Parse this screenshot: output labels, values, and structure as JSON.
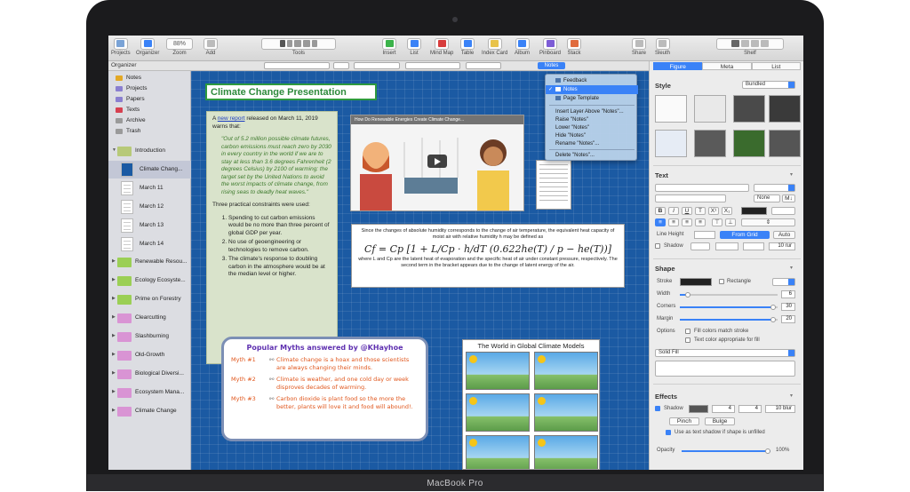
{
  "device": {
    "brand": "MacBook Pro"
  },
  "toolbar": {
    "items": [
      {
        "label": "Projects"
      },
      {
        "label": "Organizer"
      },
      {
        "label": "Zoom",
        "value": "88%"
      },
      {
        "label": "Add"
      },
      {
        "label": "Tools"
      },
      {
        "label": "Insert"
      },
      {
        "label": "List"
      },
      {
        "label": "Mind Map"
      },
      {
        "label": "Table"
      },
      {
        "label": "Index Card"
      },
      {
        "label": "Album"
      },
      {
        "label": "Pinboard"
      },
      {
        "label": "Stack"
      },
      {
        "label": "Share"
      },
      {
        "label": "Sleuth"
      },
      {
        "label": "Shelf"
      }
    ],
    "organizer_label": "Organizer",
    "notes_popup": "Notes"
  },
  "sidebar": {
    "top": [
      {
        "label": "Notes",
        "color": "#e3a825"
      },
      {
        "label": "Projects",
        "color": "#8a7fd0"
      },
      {
        "label": "Papers",
        "color": "#8a7fd0"
      },
      {
        "label": "Texts",
        "color": "#d64050"
      },
      {
        "label": "Archive",
        "color": "#9a9a9a"
      },
      {
        "label": "Trash",
        "color": "#9a9a9a"
      }
    ],
    "intro": "Introduction",
    "docs": [
      "Climate Chang...",
      "March 11",
      "March 12",
      "March 13",
      "March 14"
    ],
    "folders": [
      {
        "label": "Renewable Resou...",
        "color": "#9bcf55"
      },
      {
        "label": "Ecology Ecosyste...",
        "color": "#9bcf55"
      },
      {
        "label": "Prime on Forestry",
        "color": "#9bcf55"
      },
      {
        "label": "Clearcutting",
        "color": "#d994d4"
      },
      {
        "label": "Slashburning",
        "color": "#d994d4"
      },
      {
        "label": "Old-Growth",
        "color": "#d994d4"
      },
      {
        "label": "Biological Diversi...",
        "color": "#d994d4"
      },
      {
        "label": "Ecosystem Mana...",
        "color": "#d994d4"
      },
      {
        "label": "Climate Change",
        "color": "#d994d4"
      }
    ]
  },
  "canvas": {
    "title": "Climate Change Presentation",
    "note": {
      "intro_pre": "A ",
      "intro_link": "new report",
      "intro_post": " released on March 11, 2019 warns that:",
      "quote": "\"Out of 5.2 million possible climate futures, carbon emissions must reach zero by 2030 in every country in the world if we are to stay at less than 3.6 degrees Fahrenheit (2 degrees Celsius) by 2100 of warming: the target set by the United Nations to avoid the worst impacts of climate change, from rising seas to deadly heat waves.\"",
      "constraints_intro": "Three practical constraints were used:",
      "constraints": [
        "Spending to cut carbon emissions would be no more than three percent of global GDP per year.",
        "No use of geoengineering or technologies to remove carbon.",
        "The climate's response to doubling carbon in the atmosphere would be at the median level or higher."
      ]
    },
    "video_title": "How Do Renewable Energies Create Climate Change...",
    "equation": {
      "text_top": "Since the changes of absolute humidity corresponds to the change of air temperature, the equivalent heat capacity of moist air with relative humidity h may be defined as",
      "formula": "Cf = Cp [1 + L/Cp · h/dT (0.622he(T) / p − he(T))]",
      "text_bottom": "where L and Cp are the latent heat of evaporation and the specific heat of air under constant pressure, respectively. The second term in the bracket appears due to the change of latent energy of the air."
    },
    "myths": {
      "title": "Popular Myths answered by @KHayhoe",
      "items": [
        {
          "num": "Myth #1",
          "text": "Climate change is a hoax and those scientists are always changing their minds."
        },
        {
          "num": "Myth #2",
          "text": "Climate is weather, and one cold day or week disproves decades of warming."
        },
        {
          "num": "Myth #3",
          "text": "Carbon dioxide is plant food so the more the better, plants will love it and food will abound!."
        }
      ]
    },
    "climate_models_title": "The World in Global Climate Models"
  },
  "menu": {
    "items": [
      "Feedback",
      "Notes",
      "Page Template"
    ],
    "selected": "Notes",
    "actions": [
      "Insert Layer Above \"Notes\"...",
      "Raise \"Notes\"",
      "Lower \"Notes\"",
      "Hide \"Notes\"",
      "Rename \"Notes\"...",
      "Delete \"Notes\"..."
    ]
  },
  "inspector": {
    "tabs": [
      "Figure",
      "Meta",
      "List"
    ],
    "active_tab": "Figure",
    "style": {
      "heading": "Style",
      "preset": "Bundled"
    },
    "text": {
      "heading": "Text",
      "none_label": "None",
      "line_height": "Line Height",
      "from_grid": "From Grid",
      "auto": "Auto",
      "shadow": "Shadow",
      "shadow_size": "10 rur"
    },
    "shape": {
      "heading": "Shape",
      "stroke": "Stroke",
      "stroke_type": "Rectangle",
      "width": "Width",
      "width_val": "6",
      "corners": "Corners",
      "corners_val": "30",
      "margin": "Margin",
      "margin_val": "20",
      "options": "Options",
      "opt1": "Fill colors match stroke",
      "opt2": "Text color appropriate for fill",
      "fill": "Solid Fill"
    },
    "effects": {
      "heading": "Effects",
      "shadow": "Shadow",
      "x": "4",
      "y": "4",
      "blur": "10 blur",
      "pinch": "Pinch",
      "bulge": "Bulge",
      "text_shadow": "Use as text shadow if shape is unfilled",
      "opacity": "Opacity",
      "opacity_val": "100%"
    }
  }
}
